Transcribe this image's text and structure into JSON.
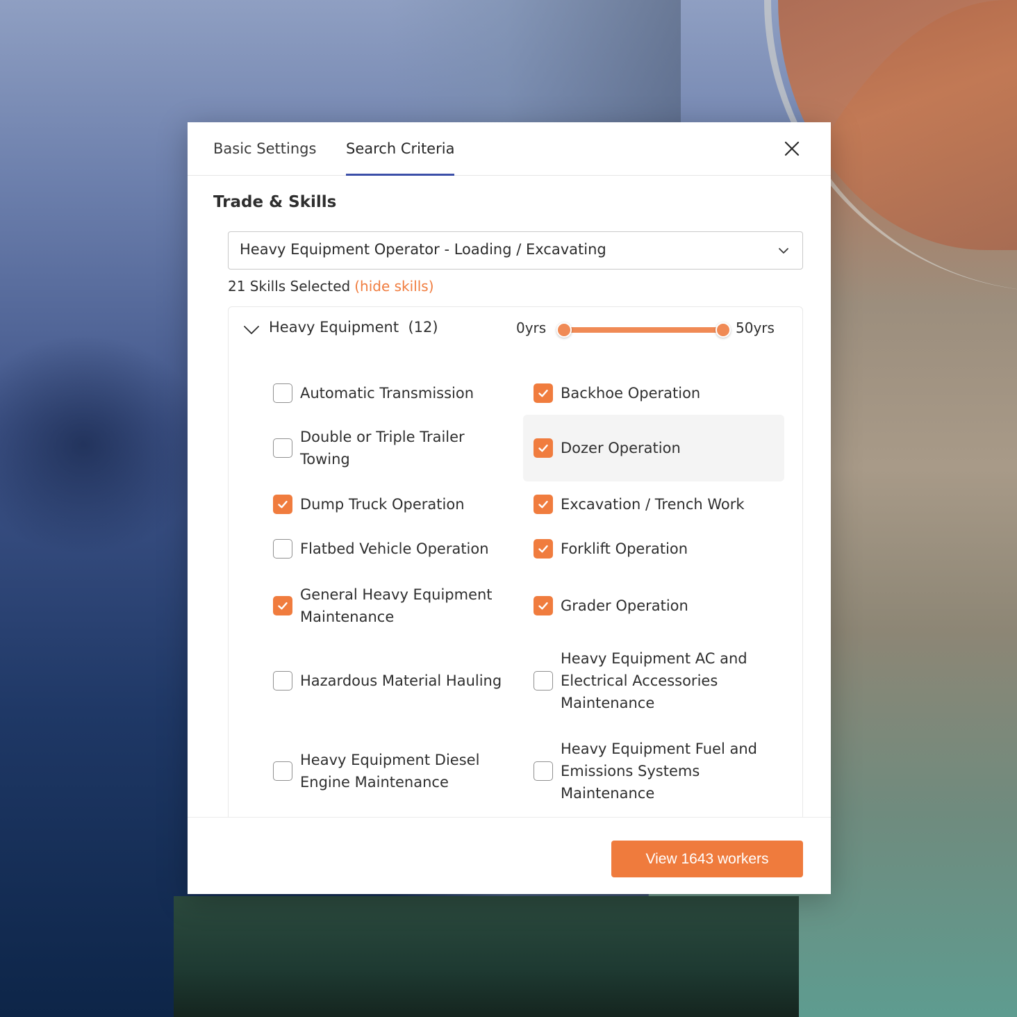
{
  "tabs": [
    {
      "label": "Basic Settings",
      "active": false
    },
    {
      "label": "Search Criteria",
      "active": true
    }
  ],
  "section": {
    "title": "Trade & Skills"
  },
  "trade_select": {
    "value": "Heavy Equipment Operator - Loading / Excavating"
  },
  "skills_summary": {
    "count_text": "21 Skills Selected",
    "toggle_link": "(hide skills)"
  },
  "group": {
    "title": "Heavy Equipment  (12)",
    "experience_min_label": "0yrs",
    "experience_max_label": "50yrs",
    "experience_range_years": [
      0,
      50
    ]
  },
  "skills": [
    {
      "label": "Automatic Transmission",
      "checked": false
    },
    {
      "label": "Backhoe Operation",
      "checked": true
    },
    {
      "label": "Double or Triple Trailer Towing",
      "checked": false
    },
    {
      "label": "Dozer Operation",
      "checked": true,
      "hovered": true
    },
    {
      "label": "Dump Truck Operation",
      "checked": true
    },
    {
      "label": "Excavation / Trench Work",
      "checked": true
    },
    {
      "label": "Flatbed Vehicle Operation",
      "checked": false
    },
    {
      "label": "Forklift Operation",
      "checked": true
    },
    {
      "label": "General Heavy Equipment Maintenance",
      "checked": true
    },
    {
      "label": "Grader Operation",
      "checked": true
    },
    {
      "label": "Hazardous Material Hauling",
      "checked": false
    },
    {
      "label": "Heavy Equipment AC and Electrical Accessories Maintenance",
      "checked": false
    },
    {
      "label": "Heavy Equipment Diesel Engine Maintenance",
      "checked": false
    },
    {
      "label": "Heavy Equipment Fuel and Emissions Systems Maintenance",
      "checked": false
    }
  ],
  "footer": {
    "primary_button": "View 1643 workers"
  },
  "colors": {
    "accent": "#ef7b3d",
    "tab_indicator": "#3b4fa8",
    "checkbox_border": "#8f8f8f"
  },
  "icons": {
    "close": "close-icon",
    "dropdown": "chevron-down-icon",
    "group_toggle": "chevron-down-icon",
    "check": "checkmark-icon"
  }
}
